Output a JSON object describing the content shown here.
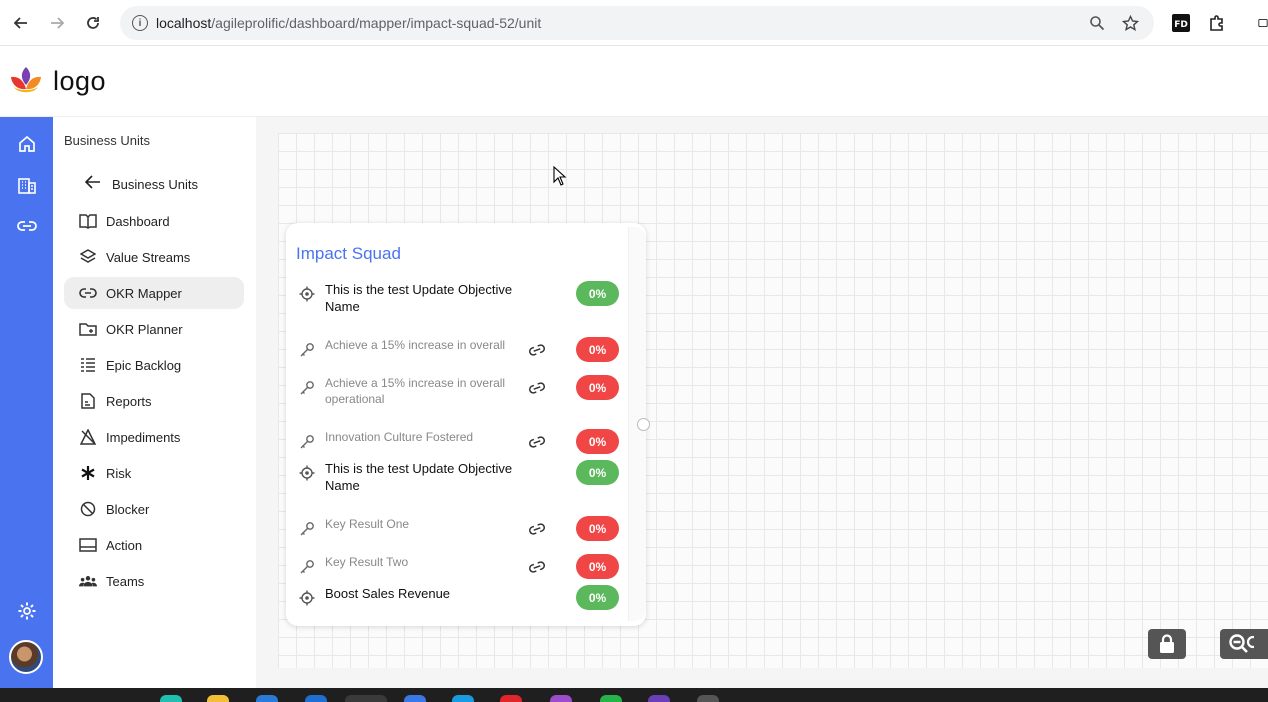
{
  "browser": {
    "url_host": "localhost",
    "url_path": "/agileprolific/dashboard/mapper/impact-squad-52/unit"
  },
  "app": {
    "logo_text": "logo"
  },
  "sidebar": {
    "title": "Business Units",
    "back_label": "Business Units",
    "items": [
      {
        "label": "Dashboard",
        "icon": "dashboard-icon"
      },
      {
        "label": "Value Streams",
        "icon": "layers-icon"
      },
      {
        "label": "OKR Mapper",
        "icon": "link-icon",
        "active": true
      },
      {
        "label": "OKR Planner",
        "icon": "folder-icon"
      },
      {
        "label": "Epic Backlog",
        "icon": "backlog-icon"
      },
      {
        "label": "Reports",
        "icon": "reports-icon"
      },
      {
        "label": "Impediments",
        "icon": "impediments-icon"
      },
      {
        "label": "Risk",
        "icon": "asterisk-icon"
      },
      {
        "label": "Blocker",
        "icon": "blocker-icon"
      },
      {
        "label": "Action",
        "icon": "action-icon"
      },
      {
        "label": "Teams",
        "icon": "teams-icon"
      }
    ]
  },
  "card": {
    "title": "Impact Squad",
    "rows": [
      {
        "type": "objective",
        "text": "This is the test Update Objective Name",
        "progress": "0%",
        "status": "green"
      },
      {
        "type": "key-result",
        "text": "Achieve a 15% increase in overall",
        "progress": "0%",
        "status": "red"
      },
      {
        "type": "key-result",
        "text": "Achieve a 15% increase in overall operational",
        "progress": "0%",
        "status": "red"
      },
      {
        "type": "key-result",
        "text": "Innovation Culture Fostered",
        "progress": "0%",
        "status": "red"
      },
      {
        "type": "objective",
        "text": "This is the test Update Objective Name",
        "progress": "0%",
        "status": "green"
      },
      {
        "type": "key-result",
        "text": "Key Result One",
        "progress": "0%",
        "status": "red"
      },
      {
        "type": "key-result",
        "text": "Key Result Two",
        "progress": "0%",
        "status": "red"
      },
      {
        "type": "objective",
        "text": "Boost Sales Revenue",
        "progress": "0%",
        "status": "green"
      }
    ]
  },
  "colors": {
    "accent": "#4a73f0",
    "green": "#5cb85c",
    "red": "#f04646"
  }
}
